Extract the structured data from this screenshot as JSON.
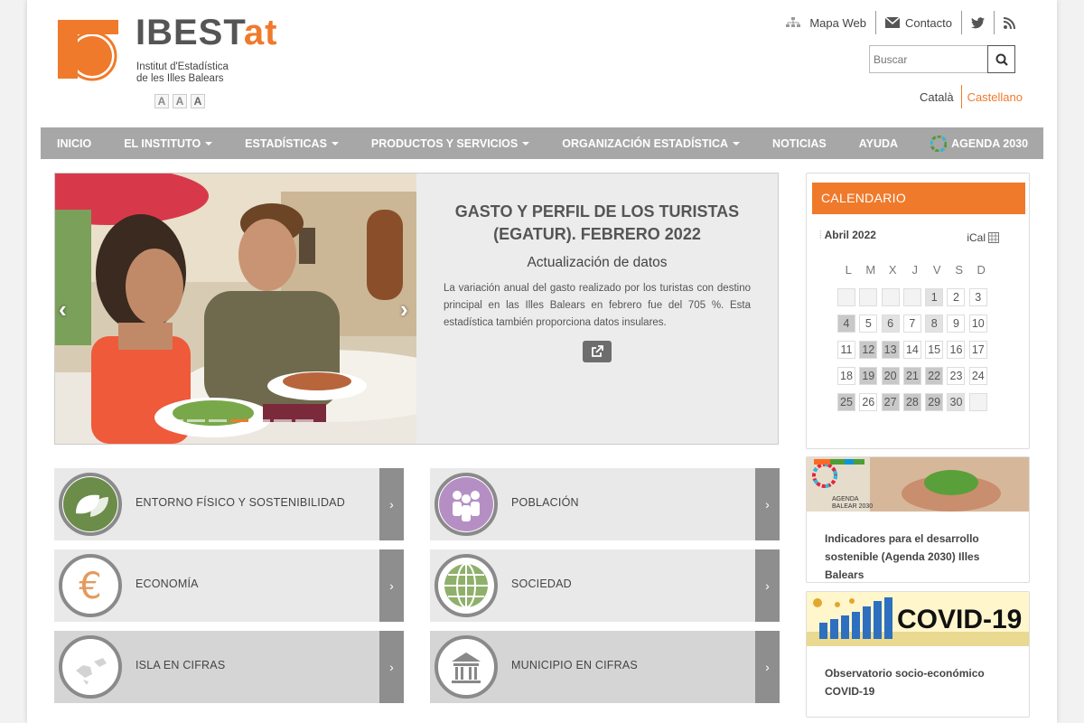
{
  "header": {
    "brand_main": "IBEST",
    "brand_accent": "at",
    "subtitle_line1": "Institut d'Estadística",
    "subtitle_line2": "de les Illes Balears",
    "font_size_buttons": [
      "A",
      "A",
      "A"
    ],
    "top_links": {
      "sitemap": "Mapa Web",
      "contact": "Contacto",
      "twitter_icon": "twitter-icon",
      "rss_icon": "rss-icon"
    },
    "search": {
      "placeholder": "Buscar"
    },
    "languages": {
      "catalan": "Català",
      "spanish": "Castellano",
      "active": "Castellano"
    }
  },
  "nav": {
    "items": [
      {
        "label": "INICIO",
        "dropdown": false
      },
      {
        "label": "EL INSTITUTO",
        "dropdown": true
      },
      {
        "label": "ESTADÍSTICAS",
        "dropdown": true
      },
      {
        "label": "PRODUCTOS Y SERVICIOS",
        "dropdown": true
      },
      {
        "label": "ORGANIZACIÓN ESTADÍSTICA",
        "dropdown": true
      },
      {
        "label": "NOTICIAS",
        "dropdown": false
      },
      {
        "label": "AYUDA",
        "dropdown": false
      },
      {
        "label": "AGENDA 2030",
        "dropdown": false
      }
    ]
  },
  "carousel": {
    "title": "GASTO Y PERFIL DE LOS TURISTAS (EGATUR). FEBRERO 2022",
    "subtitle": "Actualización de datos",
    "description": "La variación anual del gasto realizado por los turistas con destino principal en las Illes Balears en febrero fue del 705 %. Esta estadística también proporciona datos insulares.",
    "active_dot": 3,
    "dot_count": 7
  },
  "categories": [
    {
      "label": "ENTORNO FÍSICO Y SOSTENIBILIDAD",
      "icon": "leaf-icon"
    },
    {
      "label": "POBLACIÓN",
      "icon": "people-icon"
    },
    {
      "label": "ECONOMÍA",
      "icon": "euro-icon"
    },
    {
      "label": "SOCIEDAD",
      "icon": "globe-icon"
    },
    {
      "label": "ISLA EN CIFRAS",
      "icon": "islands-map-icon"
    },
    {
      "label": "MUNICIPIO EN CIFRAS",
      "icon": "town-hall-icon"
    }
  ],
  "calendar": {
    "title": "CALENDARIO",
    "month": "Abril 2022",
    "ical": "iCal",
    "weekdays": [
      "L",
      "M",
      "X",
      "J",
      "V",
      "S",
      "D"
    ],
    "days": [
      "1",
      "2",
      "3",
      "4",
      "5",
      "6",
      "7",
      "8",
      "9",
      "10",
      "11",
      "12",
      "13",
      "14",
      "15",
      "16",
      "17",
      "18",
      "19",
      "20",
      "21",
      "22",
      "23",
      "24",
      "25",
      "26",
      "27",
      "28",
      "29",
      "30"
    ],
    "highlighted_day": "27"
  },
  "sidebar_cards": [
    {
      "badge": "AGENDA BALEAR 2030",
      "text": "Indicadores para el desarrollo sostenible (Agenda 2030) Illes Balears"
    },
    {
      "badge": "COVID-19",
      "text": "Observatorio socio-económico COVID-19"
    }
  ],
  "colors": {
    "accent": "#f07a2b",
    "nav_bg": "#a7a7a7",
    "tile_bg": "#e9e9e9",
    "tile_arrow_bg": "#8e8e8e"
  }
}
